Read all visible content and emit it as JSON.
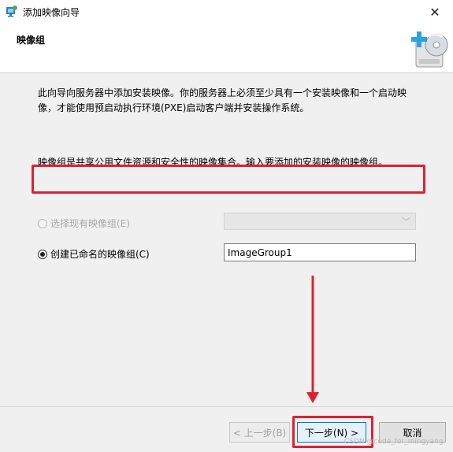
{
  "window": {
    "title": "添加映像向导",
    "close_glyph": "✕",
    "app_icon": "wizard-app-icon"
  },
  "header": {
    "page_title": "映像组",
    "icon": "disc-add-icon"
  },
  "content": {
    "intro_line1": "此向导向服务器中添加安装映像。你的服务器上必须至少具有一个安装映像和一个启动映",
    "intro_line2": "像，才能使用预启动执行环境(PXE)启动客户端并安装操作系统。",
    "description": "映像组是共享公用文件资源和安全性的映像集合。输入要添加的安装映像的映像组。",
    "option_existing_label": "选择现有映像组(E)",
    "option_existing_selected_value": "",
    "option_new_label": "创建已命名的映像组(C)",
    "new_group_name_value": "ImageGroup1"
  },
  "footer": {
    "back_label": "< 上一步(B)",
    "next_label": "下一步(N) >",
    "cancel_label": "取消"
  },
  "watermark": "CSDN @code_for_mingyang",
  "colors": {
    "highlight": "#e02030",
    "dialog_bg": "#f0f0f0",
    "primary_border": "#0078d7"
  }
}
